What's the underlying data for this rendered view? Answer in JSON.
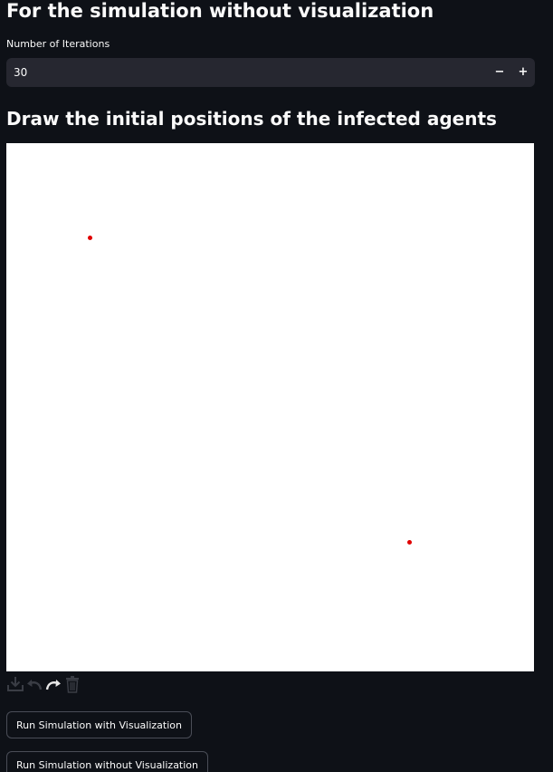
{
  "section_title": "For the simulation without visualization",
  "iterations": {
    "label": "Number of Iterations",
    "value": "30",
    "decrement": "−",
    "increment": "+"
  },
  "canvas_section": {
    "heading": "Draw the initial positions of the infected agents",
    "dot_color": "#e00000",
    "toolbar_icons": [
      "download-icon",
      "undo-icon",
      "redo-icon",
      "trash-icon"
    ]
  },
  "buttons": {
    "with_vis": "Run Simulation with Visualization",
    "without_vis": "Run Simulation without Visualization"
  }
}
